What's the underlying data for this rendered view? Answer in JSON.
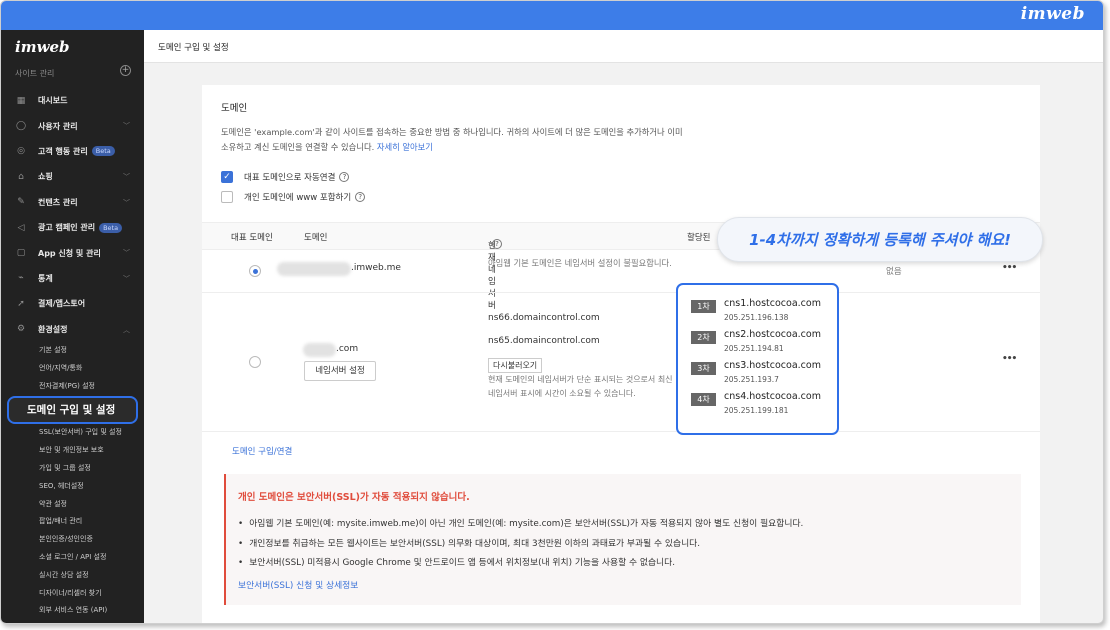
{
  "app": {
    "brand": "imweb",
    "top_brand": "imweb"
  },
  "sidebar": {
    "section": "사이트 관리",
    "items": [
      {
        "icon": "dashboard-icon",
        "glyph": "▦",
        "label": "대시보드",
        "chevron": false,
        "beta": ""
      },
      {
        "icon": "user-icon",
        "glyph": "◯",
        "label": "사용자 관리",
        "chevron": true,
        "beta": ""
      },
      {
        "icon": "target-icon",
        "glyph": "◎",
        "label": "고객 행동 관리",
        "chevron": false,
        "beta": "Beta"
      },
      {
        "icon": "shop-icon",
        "glyph": "⌂",
        "label": "쇼핑",
        "chevron": true,
        "beta": ""
      },
      {
        "icon": "edit-icon",
        "glyph": "✎",
        "label": "컨텐츠 관리",
        "chevron": true,
        "beta": ""
      },
      {
        "icon": "megaphone-icon",
        "glyph": "◁",
        "label": "광고 캠페인 관리",
        "chevron": false,
        "beta": "Beta"
      },
      {
        "icon": "app-icon",
        "glyph": "▢",
        "label": "App 신청 및 관리",
        "chevron": true,
        "beta": ""
      },
      {
        "icon": "stats-icon",
        "glyph": "⌁",
        "label": "통계",
        "chevron": true,
        "beta": ""
      },
      {
        "icon": "rocket-icon",
        "glyph": "➚",
        "label": "결제/앱스토어",
        "chevron": false,
        "beta": ""
      },
      {
        "icon": "gear-icon",
        "glyph": "⚙",
        "label": "환경설정",
        "chevron": true,
        "beta": ""
      }
    ],
    "sub_items": [
      "기본 설정",
      "언어/지역/통화",
      "전자결제(PG) 설정",
      "도메인 구입 및 설정",
      "SSL(보안서버) 구입 및 설정",
      "보안 및 개인정보 보호",
      "가입 및 그룹 설정",
      "SEO, 헤더설정",
      "약관 설정",
      "팝업/배너 관리",
      "본인인증/성인인증",
      "소셜 로그인 / API 설정",
      "실시간 상담 설정",
      "디자이너/리셀러 찾기",
      "외부 서비스 연동 (API)"
    ]
  },
  "header": {
    "title": "도메인 구입 및 설정"
  },
  "domain_card": {
    "title": "도메인",
    "desc": "도메인은 'example.com'과 같이 사이트를 접속하는 중요한 방법 중 하나입니다. 귀하의 사이트에 더 많은 도메인을 추가하거나 이미 소유하고 계신 도메인을 연결할 수 있습니다. ",
    "learn_more": "자세히 알아보기",
    "auto_connect": "대표 도메인으로 자동연결",
    "include_www": "개인 도메인에 www 포함하기",
    "columns": {
      "primary": "대표 도메인",
      "domain": "도메인",
      "nameserver": "현재 네임서버",
      "assigned": "할당된"
    },
    "row1": {
      "domain_suffix": ".imweb.me",
      "nameserver_note": "아임웹 기본 도메인은 네임서버 설정이 불필요합니다.",
      "assigned": "없음",
      "more": "•••"
    },
    "row2": {
      "domain_suffix": ".com",
      "ns_button": "네임서버 설정",
      "current_ns": [
        "ns66.domaincontrol.com",
        "ns65.domaincontrol.com"
      ],
      "reload": "다시불러오기",
      "note": "현재 도메인의 네임서버가 단순 표시되는 것으로서 최신 네임서버 표시에 시간이 소요될 수 있습니다.",
      "more": "•••"
    },
    "assigned_ns": [
      {
        "tag": "1차",
        "host": "cns1.hostcocoa.com",
        "ip": "205.251.196.138"
      },
      {
        "tag": "2차",
        "host": "cns2.hostcocoa.com",
        "ip": "205.251.194.81"
      },
      {
        "tag": "3차",
        "host": "cns3.hostcocoa.com",
        "ip": "205.251.193.7"
      },
      {
        "tag": "4차",
        "host": "cns4.hostcocoa.com",
        "ip": "205.251.199.181"
      }
    ],
    "callout": "1-4차까지 정확하게 등록해 주셔야 해요!",
    "buy_link": "도메인 구입/연결",
    "warning": {
      "title": "개인 도메인은 보안서버(SSL)가 자동 적용되지 않습니다.",
      "bullets": [
        "아임웹 기본 도메인(예: mysite.imweb.me)이 아닌 개인 도메인(예: mysite.com)은 보안서버(SSL)가 자동 적용되지 않아 별도 신청이 필요합니다.",
        "개인정보를 취급하는 모든 웹사이트는 보안서버(SSL) 의무화 대상이며, 최대 3천만원 이하의 과태료가 부과될 수 있습니다.",
        "보안서버(SSL) 미적용시 Google Chrome 및 안드로이드 앱 등에서 위치정보(내 위치) 기능을 사용할 수 없습니다."
      ],
      "link": "보안서버(SSL) 신청 및 상세정보"
    }
  }
}
